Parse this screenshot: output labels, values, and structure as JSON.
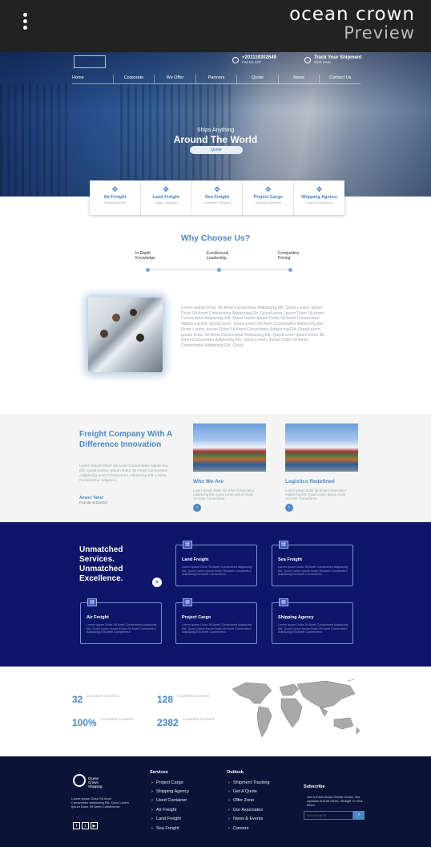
{
  "app": {
    "brand": "ocean crown",
    "mode": "Preview"
  },
  "hero": {
    "phone": "+201119302649",
    "phone_sub": "Call Us 24/7",
    "track": "Track Your Shipment",
    "track_sub": "Click Here",
    "nav": [
      "Home",
      "Corporate",
      "We Offer",
      "Partners",
      "Quote",
      "News",
      "Contact Us"
    ],
    "tagline_small": "Ships Anything",
    "tagline_big": "Around The World",
    "cta": "Quote"
  },
  "services_strip": [
    {
      "title": "Air Freight",
      "sub": "Shipping World"
    },
    {
      "title": "Land Freight",
      "sub": "Cargo Transport"
    },
    {
      "title": "Sea Freight",
      "sub": "Container Shipping"
    },
    {
      "title": "Project Cargo",
      "sub": "Handling Services"
    },
    {
      "title": "Shipping Agency",
      "sub": "Trusted Operations"
    }
  ],
  "why": {
    "title": "Why Choose Us?",
    "items": [
      "In-Depth Knowledge",
      "Excellence& Leadership",
      "Competitive Pricing"
    ],
    "paragraph": "Lorem Ipsum Dolor Sit Amet Consectetur Adipiscing Elit. Quod Lorem. Ipsum Dolor Sit Amet Consectetur Adipiscing Elit. QuodLorem, Ipsum Dolor Sit Amet Consectetur Adipiscing Elit. Quod Lorem Ipsum Dolor Sit Amet Consectetur Adipiscing Elit. QuodLorem, Ipsum Dolor Sit Amet Consectetur Adipiscing Elit. Quod Lorem, Ipsum Dolor Sit Amet Consectetur Adipiscing Elit. QuodLorem, Ipsum Dolor Sit Amet Consectetur Adipiscing Elit. QuodLorem Ipsum Dolor Sit Amet Consectetur Adipiscing Elit. Quod Lorem, Ipsum Dolor Sit Amet Consectetur Adipiscing Elit. Quod"
  },
  "freight": {
    "title": "Freight Company With A Difference Innovation",
    "desc": "Lorem Ipsum Dolor Sit Amet Consectetur Adipiscing Elit. Quod Lorem. Ipsum Dolor Sit Amet Consectetur Adipiscing Amet Consectetur Adipiscing Elit. I Amet Consectetur Adipiscin.",
    "name": "Ameer Taher",
    "role": "Founder & Director",
    "cards": [
      {
        "title": "Who We Are",
        "text": "Lorem Ipsum Dolor Sit Amet Consectetur Adipiscing Elit. Quod Lorem Ipsum Dolor Sit Amet Consectetur."
      },
      {
        "title": "Logistics Redefined",
        "text": "Lorem Ipsum Dolor Sit Amet Consectetur Adipiscing Elit. Quod Lorem Ipsum Dolor Sit Amet Consectetur."
      }
    ]
  },
  "unmatched": {
    "heading": "Unmatched Services. Unmatched Excellence.",
    "box_text": "Lorem Ipsum Dolor Sit Amet Consectetur Adipiscing Elit. Quod Lorem Ipsum Dolor Sit Amet Consectetur Adipiscing Elit Amet Consectetur.",
    "boxes": [
      "Land Freight",
      "Sea Freight",
      "Air Freight",
      "Project Cargo",
      "Shipping Agency"
    ]
  },
  "stats": [
    {
      "value": "32",
      "label": "Countries Covered"
    },
    {
      "value": "128",
      "label": "Countries Covered"
    },
    {
      "value": "100%",
      "label": "Countries Covered"
    },
    {
      "value": "2382",
      "label": "Countries Covered"
    }
  ],
  "footer": {
    "logo_text": "Ocean Crown Shipping",
    "about": "Lorem Ipsum Dolor Sit Amet Consectetur Adipiscing Elit. Quod Lorem Ipsum Dolor Sit Amet Consectetur.",
    "social": [
      "f",
      "t",
      "▶"
    ],
    "services_title": "Services",
    "services": [
      "Project Cargo",
      "Shipping Agency",
      "Used Container",
      "Air Freight",
      "Land Freight",
      "Sea Freight"
    ],
    "outlook_title": "Outlook",
    "outlook": [
      "Shipment Tracking",
      "Get A Quote",
      "Offer Zone",
      "Our Associates",
      "News & Events",
      "Careers"
    ],
    "subscribe_title": "Subscribe",
    "subscribe_text": "Get A Know About Ocean Crown, Our Updates And All News, Straight To Your Inbox",
    "email_placeholder": "Your Email ID",
    "submit_icon": "›"
  },
  "colors": {
    "accent": "#4d88c4",
    "navy": "#0d1668",
    "footer": "#0b1438"
  }
}
